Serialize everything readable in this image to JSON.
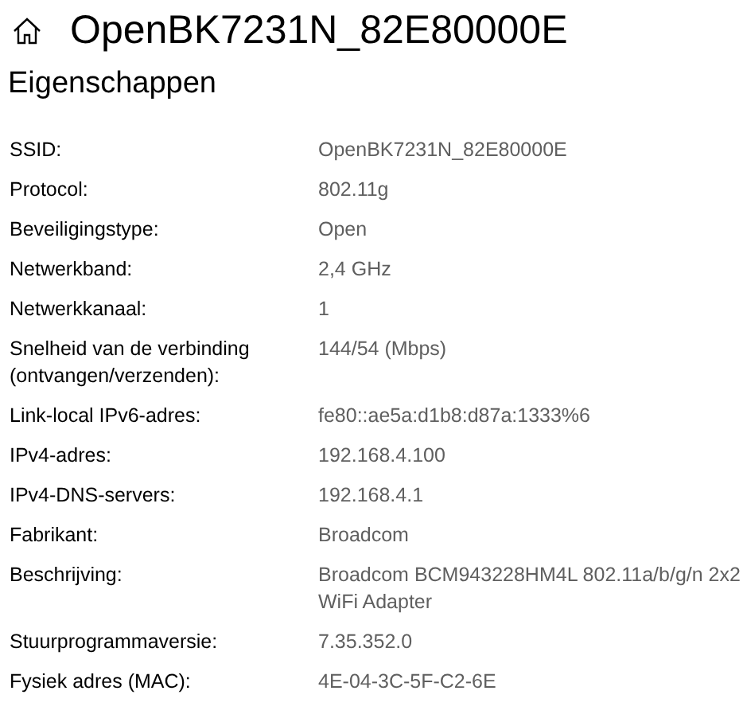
{
  "header": {
    "title": "OpenBK7231N_82E80000E"
  },
  "section": {
    "title": "Eigenschappen"
  },
  "properties": [
    {
      "label": "SSID:",
      "value": "OpenBK7231N_82E80000E"
    },
    {
      "label": "Protocol:",
      "value": "802.11g"
    },
    {
      "label": "Beveiligingstype:",
      "value": "Open"
    },
    {
      "label": "Netwerkband:",
      "value": "2,4 GHz"
    },
    {
      "label": "Netwerkkanaal:",
      "value": "1"
    },
    {
      "label": "Snelheid van de verbinding (ontvangen/verzenden):",
      "value": "144/54 (Mbps)"
    },
    {
      "label": "Link-local IPv6-adres:",
      "value": "fe80::ae5a:d1b8:d87a:1333%6"
    },
    {
      "label": "IPv4-adres:",
      "value": "192.168.4.100"
    },
    {
      "label": "IPv4-DNS-servers:",
      "value": "192.168.4.1"
    },
    {
      "label": "Fabrikant:",
      "value": "Broadcom"
    },
    {
      "label": "Beschrijving:",
      "value": "Broadcom BCM943228HM4L 802.11a/b/g/n 2x2 WiFi Adapter"
    },
    {
      "label": "Stuurprogrammaversie:",
      "value": "7.35.352.0"
    },
    {
      "label": "Fysiek adres (MAC):",
      "value": "4E-04-3C-5F-C2-6E"
    }
  ]
}
